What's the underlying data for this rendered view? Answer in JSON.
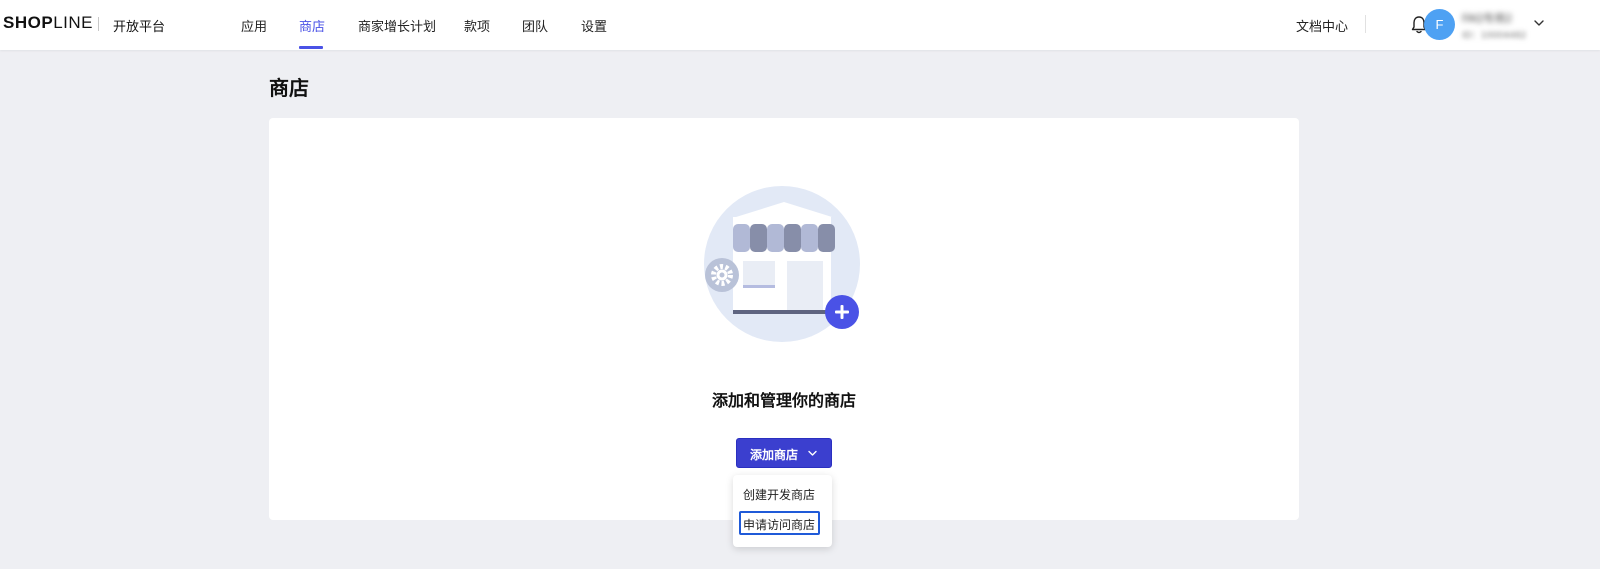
{
  "header": {
    "logo_shop": "SHOP",
    "logo_line": "LINE",
    "platform": "开放平台",
    "tabs": [
      {
        "label": "应用",
        "active": false
      },
      {
        "label": "商店",
        "active": true
      },
      {
        "label": "商家增长计划",
        "active": false
      },
      {
        "label": "款项",
        "active": false
      },
      {
        "label": "团队",
        "active": false
      },
      {
        "label": "设置",
        "active": false
      }
    ],
    "doc_link": "文档中心",
    "avatar_initial": "F",
    "account_name": "FAQ专用2",
    "account_id": "ID：10004482"
  },
  "page": {
    "title": "商店"
  },
  "empty_state": {
    "heading": "添加和管理你的商店",
    "add_button_label": "添加商店",
    "dropdown_items": [
      "创建开发商店",
      "申请访问商店"
    ]
  },
  "colors": {
    "accent": "#4a52e6",
    "button": "#3b3fcf",
    "avatar": "#4ea1f3",
    "background": "#eeeff3"
  },
  "icons": [
    "bell-icon",
    "chevron-down-icon",
    "gear-icon",
    "plus-icon",
    "store-icon"
  ]
}
